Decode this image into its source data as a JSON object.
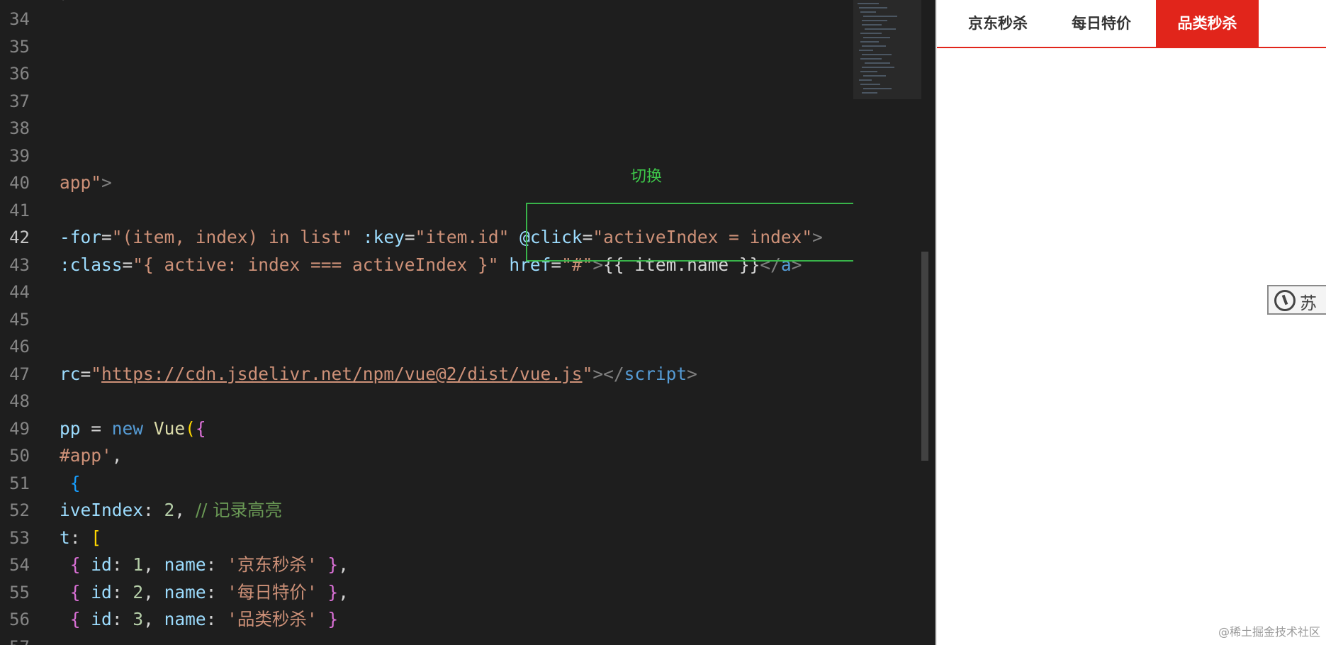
{
  "editor": {
    "line_numbers": [
      "34",
      "35",
      "36",
      "37",
      "38",
      "39",
      "40",
      "41",
      "42",
      "43",
      "44",
      "45",
      "46",
      "47",
      "48",
      "49",
      "50",
      "51",
      "52",
      "53",
      "54",
      "55",
      "56",
      "57"
    ],
    "current_line": "42",
    "lines": {
      "l33": [
        {
          "t": ")",
          "c": "t"
        }
      ],
      "l40": [
        {
          "t": "app\"",
          "c": "s"
        },
        {
          "t": ">",
          "c": "t"
        }
      ],
      "l42": [
        {
          "t": "-for",
          "c": "a"
        },
        {
          "t": "=",
          "c": ""
        },
        {
          "t": "\"(item, index) in list\"",
          "c": "s"
        },
        {
          "t": " ",
          "c": ""
        },
        {
          "t": ":key",
          "c": "a"
        },
        {
          "t": "=",
          "c": ""
        },
        {
          "t": "\"item.id\"",
          "c": "s"
        },
        {
          "t": " ",
          "c": ""
        },
        {
          "t": "@click",
          "c": "a"
        },
        {
          "t": "=",
          "c": ""
        },
        {
          "t": "\"activeIndex = index\"",
          "c": "s"
        },
        {
          "t": ">",
          "c": "t"
        }
      ],
      "l43": [
        {
          "t": ":class",
          "c": "a"
        },
        {
          "t": "=",
          "c": ""
        },
        {
          "t": "\"{ active: index === activeIndex }\"",
          "c": "s"
        },
        {
          "t": " ",
          "c": ""
        },
        {
          "t": "href",
          "c": "a"
        },
        {
          "t": "=",
          "c": ""
        },
        {
          "t": "\"#\"",
          "c": "s"
        },
        {
          "t": ">",
          "c": "t"
        },
        {
          "t": "{{ item.name }}",
          "c": ""
        },
        {
          "t": "</",
          "c": "t"
        },
        {
          "t": "a",
          "c": "tag"
        },
        {
          "t": ">",
          "c": "t"
        }
      ],
      "l47": [
        {
          "t": "rc",
          "c": "a"
        },
        {
          "t": "=",
          "c": ""
        },
        {
          "t": "\"",
          "c": "s"
        },
        {
          "t": "https://cdn.jsdelivr.net/npm/vue@2/dist/vue.js",
          "c": "s u"
        },
        {
          "t": "\"",
          "c": "s"
        },
        {
          "t": "></",
          "c": "t"
        },
        {
          "t": "script",
          "c": "tag"
        },
        {
          "t": ">",
          "c": "t"
        }
      ],
      "l49": [
        {
          "t": "pp",
          "c": "a"
        },
        {
          "t": " = ",
          "c": ""
        },
        {
          "t": "new",
          "c": "k"
        },
        {
          "t": " ",
          "c": ""
        },
        {
          "t": "Vue",
          "c": "f"
        },
        {
          "t": "(",
          "c": "y"
        },
        {
          "t": "{",
          "c": "p"
        }
      ],
      "l50": [
        {
          "t": "#app'",
          "c": "s"
        },
        {
          "t": ",",
          "c": ""
        }
      ],
      "l51": [
        {
          "t": " ",
          "c": ""
        },
        {
          "t": "{",
          "c": "b"
        }
      ],
      "l52": [
        {
          "t": "iveIndex",
          "c": "a"
        },
        {
          "t": ": ",
          "c": ""
        },
        {
          "t": "2",
          "c": "n"
        },
        {
          "t": ", ",
          "c": ""
        },
        {
          "t": "// 记录高亮",
          "c": "c"
        }
      ],
      "l53": [
        {
          "t": "t",
          "c": "a"
        },
        {
          "t": ": ",
          "c": ""
        },
        {
          "t": "[",
          "c": "y"
        }
      ],
      "l54": [
        {
          "t": " ",
          "c": ""
        },
        {
          "t": "{",
          "c": "p"
        },
        {
          "t": " ",
          "c": ""
        },
        {
          "t": "id",
          "c": "a"
        },
        {
          "t": ": ",
          "c": ""
        },
        {
          "t": "1",
          "c": "n"
        },
        {
          "t": ", ",
          "c": ""
        },
        {
          "t": "name",
          "c": "a"
        },
        {
          "t": ": ",
          "c": ""
        },
        {
          "t": "'京东秒杀'",
          "c": "s"
        },
        {
          "t": " ",
          "c": ""
        },
        {
          "t": "}",
          "c": "p"
        },
        {
          "t": ",",
          "c": ""
        }
      ],
      "l55": [
        {
          "t": " ",
          "c": ""
        },
        {
          "t": "{",
          "c": "p"
        },
        {
          "t": " ",
          "c": ""
        },
        {
          "t": "id",
          "c": "a"
        },
        {
          "t": ": ",
          "c": ""
        },
        {
          "t": "2",
          "c": "n"
        },
        {
          "t": ", ",
          "c": ""
        },
        {
          "t": "name",
          "c": "a"
        },
        {
          "t": ": ",
          "c": ""
        },
        {
          "t": "'每日特价'",
          "c": "s"
        },
        {
          "t": " ",
          "c": ""
        },
        {
          "t": "}",
          "c": "p"
        },
        {
          "t": ",",
          "c": ""
        }
      ],
      "l56": [
        {
          "t": " ",
          "c": ""
        },
        {
          "t": "{",
          "c": "p"
        },
        {
          "t": " ",
          "c": ""
        },
        {
          "t": "id",
          "c": "a"
        },
        {
          "t": ": ",
          "c": ""
        },
        {
          "t": "3",
          "c": "n"
        },
        {
          "t": ", ",
          "c": ""
        },
        {
          "t": "name",
          "c": "a"
        },
        {
          "t": ": ",
          "c": ""
        },
        {
          "t": "'品类秒杀'",
          "c": "s"
        },
        {
          "t": " ",
          "c": ""
        },
        {
          "t": "}",
          "c": "p"
        }
      ]
    }
  },
  "annotation": {
    "label": "切换",
    "color": "#39b44a"
  },
  "preview": {
    "tabs": [
      {
        "label": "京东秒杀",
        "active": false
      },
      {
        "label": "每日特价",
        "active": false
      },
      {
        "label": "品类秒杀",
        "active": true
      }
    ],
    "accent_color": "#e1251b",
    "widget_icon": "timer-icon",
    "widget_text": "苏"
  },
  "watermark": "@稀土掘金技术社区"
}
